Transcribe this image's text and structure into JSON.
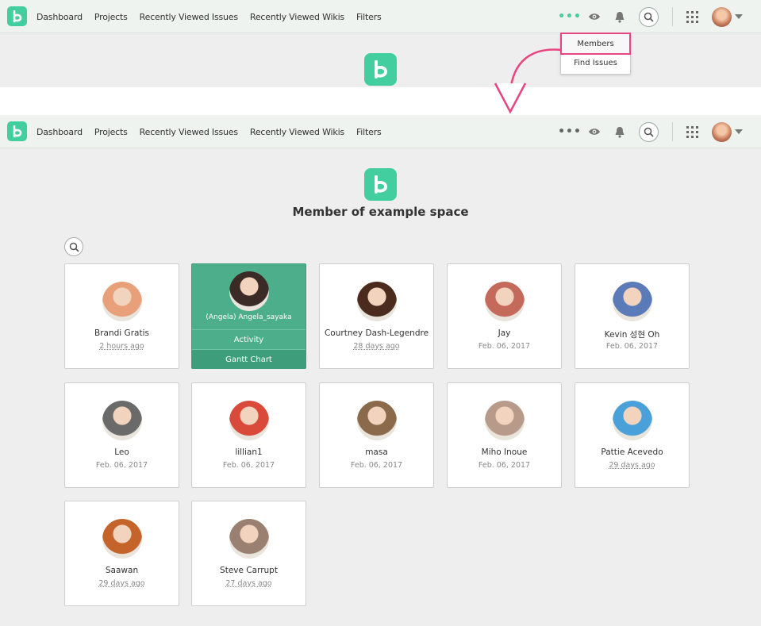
{
  "nav": {
    "links": [
      "Dashboard",
      "Projects",
      "Recently Viewed Issues",
      "Recently Viewed Wikis",
      "Filters"
    ],
    "more_icon": "more-dots-icon",
    "watch_icon": "eye-icon",
    "notification_icon": "bell-icon",
    "search_icon": "search-icon",
    "apps_icon": "grid-icon",
    "logo_letter": "b"
  },
  "dropdown": {
    "items": [
      "Members",
      "Find Issues"
    ]
  },
  "page": {
    "title": "Member of example space"
  },
  "members": [
    {
      "name": "Brandi Gratis",
      "date": "2 hours ago",
      "relative": true,
      "color": "#e8a07a"
    },
    {
      "name": "(Angela) Angela_sayaka",
      "date": "",
      "relative": false,
      "color": "#3b2b26",
      "active": true,
      "actions": [
        "Activity",
        "Gantt Chart"
      ]
    },
    {
      "name": "Courtney Dash-Legendre",
      "date": "28 days ago",
      "relative": true,
      "color": "#4a2b1e"
    },
    {
      "name": "Jay",
      "date": "Feb. 06, 2017",
      "relative": false,
      "color": "#c46a5a"
    },
    {
      "name": "Kevin 성현 Oh",
      "date": "Feb. 06, 2017",
      "relative": false,
      "color": "#5a7ab8"
    },
    {
      "name": "Leo",
      "date": "Feb. 06, 2017",
      "relative": false,
      "color": "#6a6a6a"
    },
    {
      "name": "lillian1",
      "date": "Feb. 06, 2017",
      "relative": false,
      "color": "#d94a3a"
    },
    {
      "name": "masa",
      "date": "Feb. 06, 2017",
      "relative": false,
      "color": "#8a6a4a"
    },
    {
      "name": "Miho Inoue",
      "date": "Feb. 06, 2017",
      "relative": false,
      "color": "#b89a8a"
    },
    {
      "name": "Pattie Acevedo",
      "date": "29 days ago",
      "relative": true,
      "color": "#4aa0d8"
    },
    {
      "name": "Saawan",
      "date": "29 days ago",
      "relative": true,
      "color": "#c4632a"
    },
    {
      "name": "Steve Carrupt",
      "date": "27 days ago",
      "relative": true,
      "color": "#9a8070"
    }
  ],
  "colors": {
    "brand": "#42ce9f",
    "highlight": "#e8447f",
    "active_card": "#4dae8c"
  }
}
